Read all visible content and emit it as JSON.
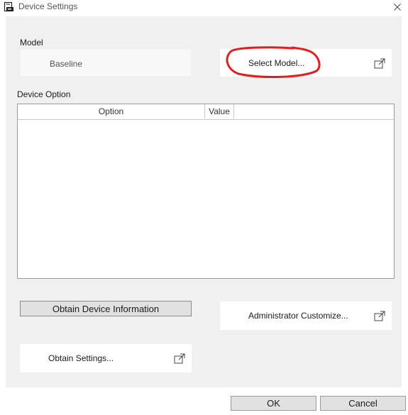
{
  "window": {
    "title": "Device Settings",
    "close_icon": "close-icon",
    "app_icon": "printer-document-icon"
  },
  "model": {
    "label": "Model",
    "current_model": "Baseline",
    "select_button": "Select Model..."
  },
  "device_option": {
    "label": "Device Option",
    "columns": [
      "Option",
      "Value"
    ],
    "rows": []
  },
  "buttons": {
    "obtain_device_info": "Obtain Device Information",
    "admin_customize": "Administrator Customize...",
    "obtain_settings": "Obtain Settings...",
    "ok": "OK",
    "cancel": "Cancel"
  },
  "annotation": {
    "color": "#e0201e"
  }
}
